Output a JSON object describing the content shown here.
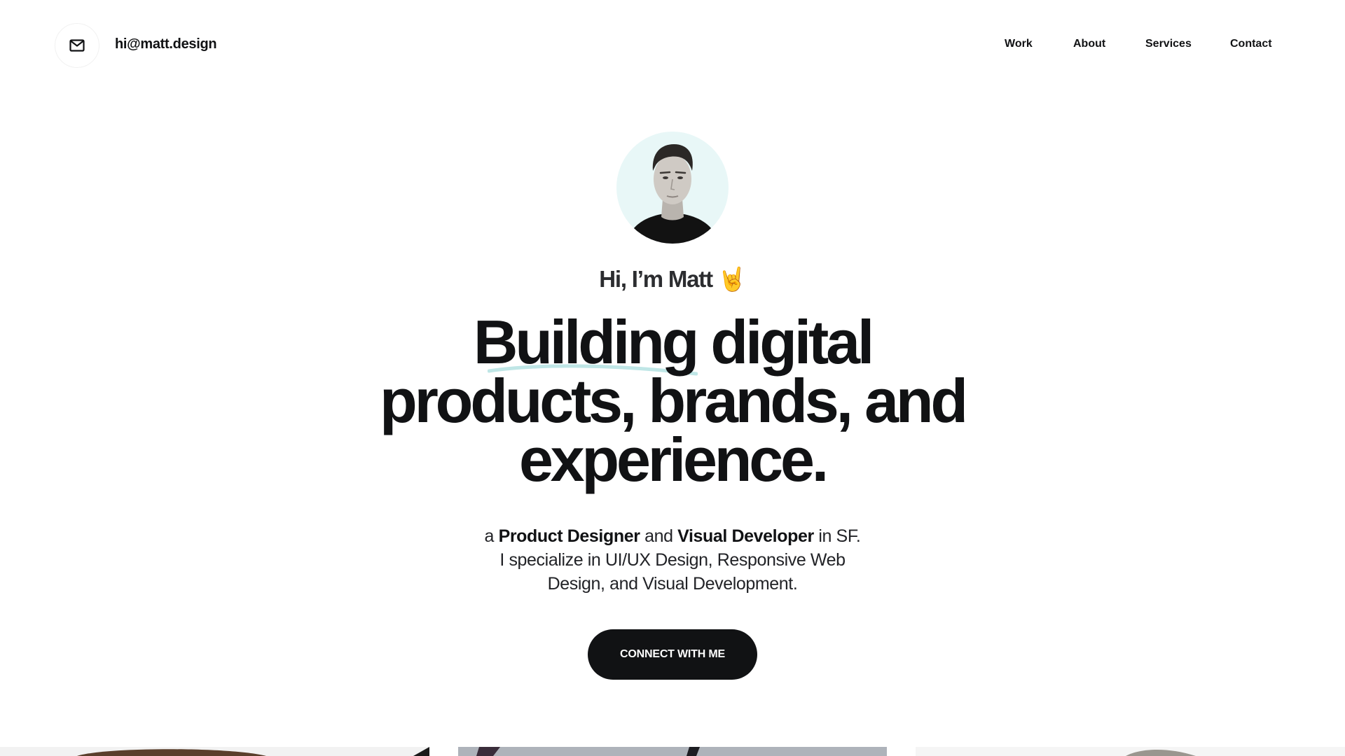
{
  "header": {
    "email": "hi@matt.design",
    "mail_icon": "envelope-icon",
    "nav": [
      {
        "label": "Work"
      },
      {
        "label": "About"
      },
      {
        "label": "Services"
      },
      {
        "label": "Contact"
      }
    ]
  },
  "hero": {
    "avatar_icon": "profile-photo",
    "greeting": "Hi, I’m Matt",
    "greeting_emoji": "🤘",
    "headline_lines": [
      "Building digital",
      "products, brands, and",
      "experience."
    ],
    "sub": {
      "prefix": "a ",
      "role1": "Product Designer",
      "and": " and ",
      "role2": "Visual Developer",
      "suffix": " in SF.",
      "line2": "I specialize in UI/UX Design, Responsive Web",
      "line3": "Design, and Visual Development."
    },
    "cta_label": "CONNECT WITH ME"
  },
  "colors": {
    "text": "#111214",
    "avatar_bg": "#e8f7f7",
    "accent_underline": "#bfe6e6",
    "button_bg": "#111214",
    "button_text": "#ffffff"
  }
}
